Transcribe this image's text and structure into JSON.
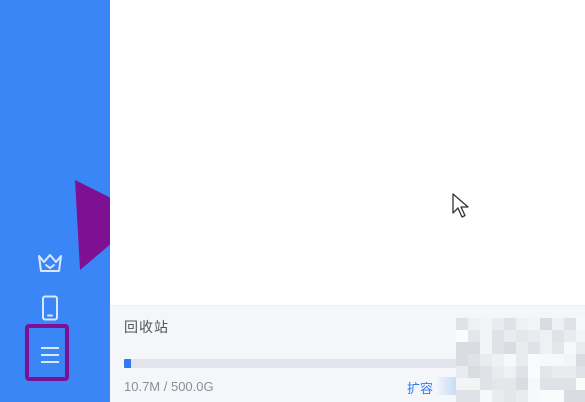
{
  "sidebar": {
    "background": "#3b86f6",
    "icons": [
      {
        "name": "crown-icon"
      },
      {
        "name": "phone-icon"
      },
      {
        "name": "menu-icon"
      }
    ]
  },
  "annotation": {
    "color": "#7e1193"
  },
  "footer": {
    "recycle_label": "回收站",
    "storage_text": "10.7M / 500.0G",
    "expand_label": "扩容",
    "progress": 0.02,
    "accent": "#2f7bf0"
  }
}
